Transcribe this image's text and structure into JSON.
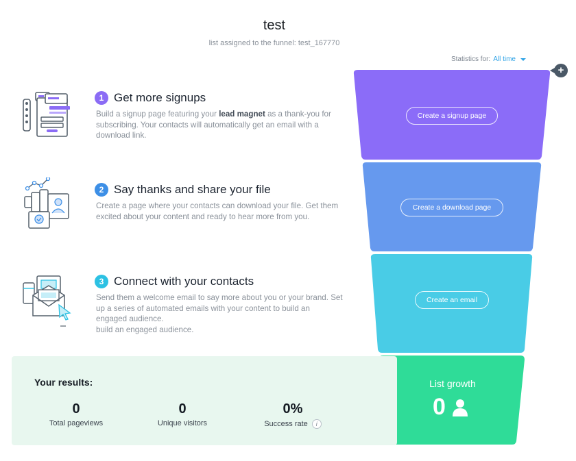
{
  "header": {
    "title": "test",
    "subtitle": "list assigned to the funnel: test_167770"
  },
  "statistics": {
    "label": "Statistics for:",
    "period": "All time"
  },
  "steps": [
    {
      "number": "1",
      "heading": "Get more signups",
      "desc_prefix": "Build a signup page featuring your ",
      "desc_bold": "lead magnet",
      "desc_suffix": " as a thank-you for subscribing. Your contacts will automatically get an email with a download link.",
      "accent": "#8b6cf5",
      "icon": "signup-form-icon"
    },
    {
      "number": "2",
      "heading": "Say thanks and share your file",
      "desc": "Create a page where your contacts can download your file. Get them excited about your content and ready to hear more from you.",
      "accent": "#3d8fe6",
      "icon": "download-file-icon"
    },
    {
      "number": "3",
      "heading": "Connect with your contacts",
      "desc": "Send them a welcome email to say more about you or your brand. Set up a series of automated emails with your content to build an engaged audience.",
      "desc_extra": "build an engaged audience.",
      "accent": "#2cc1e3",
      "icon": "email-envelope-icon"
    }
  ],
  "funnel": {
    "stage1_button": "Create a signup page",
    "stage2_button": "Create a download page",
    "stage3_button": "Create an email",
    "colors": [
      "#8b6cf8",
      "#6699ee",
      "#49cce6",
      "#2fdc98"
    ]
  },
  "results": {
    "title": "Your results:",
    "metrics": [
      {
        "value": "0",
        "label": "Total pageviews"
      },
      {
        "value": "0",
        "label": "Unique visitors"
      },
      {
        "value": "0%",
        "label": "Success rate"
      }
    ]
  },
  "growth": {
    "title": "List growth",
    "value": "0"
  }
}
